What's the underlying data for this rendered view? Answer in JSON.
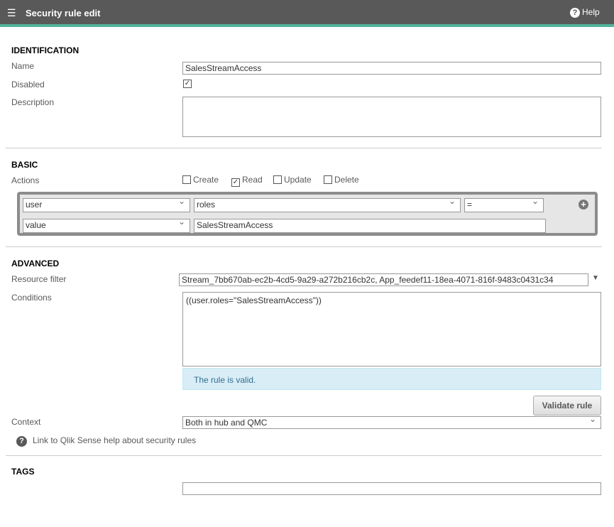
{
  "header": {
    "title": "Security rule edit",
    "help": "Help",
    "menu_icon": "list-edit-icon",
    "help_icon": "question-circle-icon",
    "accent": "#52b49a"
  },
  "identification": {
    "heading": "IDENTIFICATION",
    "name_label": "Name",
    "name_value": "SalesStreamAccess",
    "disabled_label": "Disabled",
    "disabled_checked": true,
    "description_label": "Description",
    "description_value": ""
  },
  "basic": {
    "heading": "BASIC",
    "actions_label": "Actions",
    "actions": [
      {
        "label": "Create",
        "checked": false
      },
      {
        "label": "Read",
        "checked": true
      },
      {
        "label": "Update",
        "checked": false
      },
      {
        "label": "Delete",
        "checked": false
      }
    ],
    "condition": {
      "row1": [
        "user",
        "roles",
        "="
      ],
      "row2_select": "value",
      "row2_value": "SalesStreamAccess"
    }
  },
  "advanced": {
    "heading": "ADVANCED",
    "resource_filter_label": "Resource filter",
    "resource_filter_value": "Stream_7bb670ab-ec2b-4cd5-9a29-a272b216cb2c, App_feedef11-18ea-4071-816f-9483c0431c34",
    "conditions_label": "Conditions",
    "conditions_value": "((user.roles=\"SalesStreamAccess\"))",
    "valid_message": "The rule is valid.",
    "validate_button": "Validate rule",
    "context_label": "Context",
    "context_value": "Both in hub and QMC",
    "help_link": "Link to Qlik Sense help about security rules"
  },
  "tags": {
    "heading": "TAGS",
    "value": ""
  }
}
